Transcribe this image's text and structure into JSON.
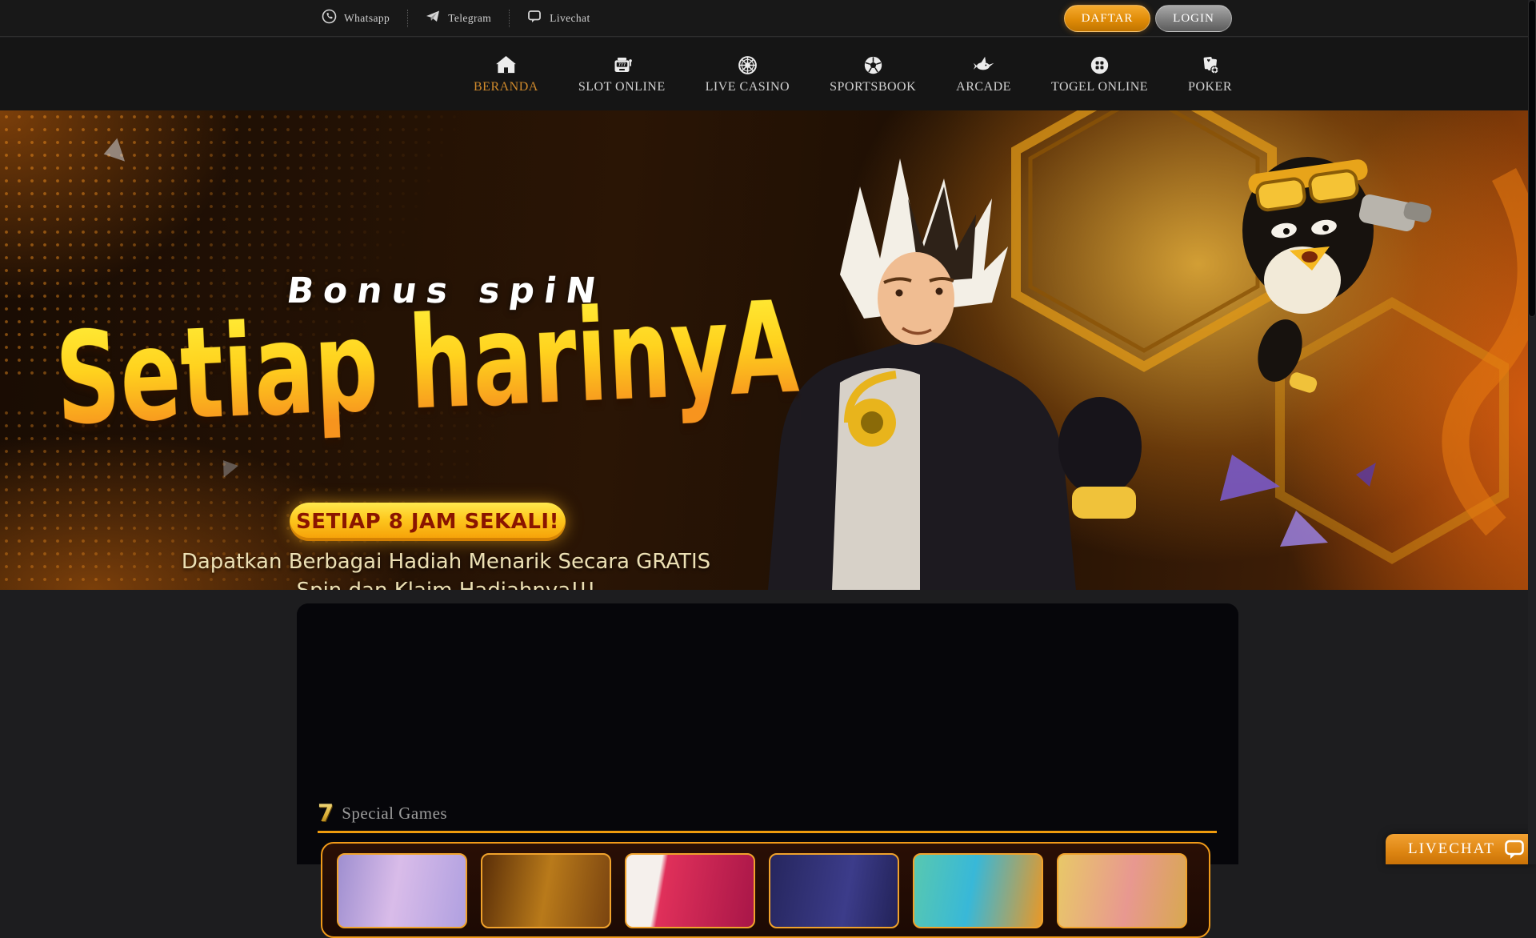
{
  "topbar": {
    "links": [
      {
        "icon": "whatsapp-icon",
        "label": "Whatsapp"
      },
      {
        "icon": "telegram-icon",
        "label": "Telegram"
      },
      {
        "icon": "livechat-icon",
        "label": "Livechat"
      }
    ],
    "register_label": "DAFTAR",
    "login_label": "LOGIN"
  },
  "nav": {
    "items": [
      {
        "icon": "home-icon",
        "label": "BERANDA",
        "active": true
      },
      {
        "icon": "slot-machine-icon",
        "label": "SLOT ONLINE",
        "active": false
      },
      {
        "icon": "roulette-icon",
        "label": "LIVE CASINO",
        "active": false
      },
      {
        "icon": "soccer-ball-icon",
        "label": "SPORTSBOOK",
        "active": false
      },
      {
        "icon": "fish-icon",
        "label": "ARCADE",
        "active": false
      },
      {
        "icon": "number-grid-icon",
        "label": "TOGEL ONLINE",
        "active": false
      },
      {
        "icon": "poker-cards-icon",
        "label": "POKER",
        "active": false
      }
    ]
  },
  "banner": {
    "title_small": "Bonus spiN",
    "title_big": "Setiap harinyA",
    "badge": "SETIAP 8 JAM SEKALI!",
    "subtitle_line1": "Dapatkan Berbagai Hadiah Menarik Secara GRATIS",
    "subtitle_line2": "Spin dan Klaim Hadiahnya!!!"
  },
  "sections": {
    "special_games": {
      "icon_glyph": "7",
      "title": "Special Games",
      "card_count": 6
    }
  },
  "livechat": {
    "label": "LIVECHAT"
  },
  "colors": {
    "accent_orange": "#f09a19",
    "nav_active": "#d08a2c",
    "badge_text": "#8a1500",
    "banner_subtitle": "#ece0b4",
    "register_button": "#e08c08",
    "login_button": "#7d7d7d"
  }
}
